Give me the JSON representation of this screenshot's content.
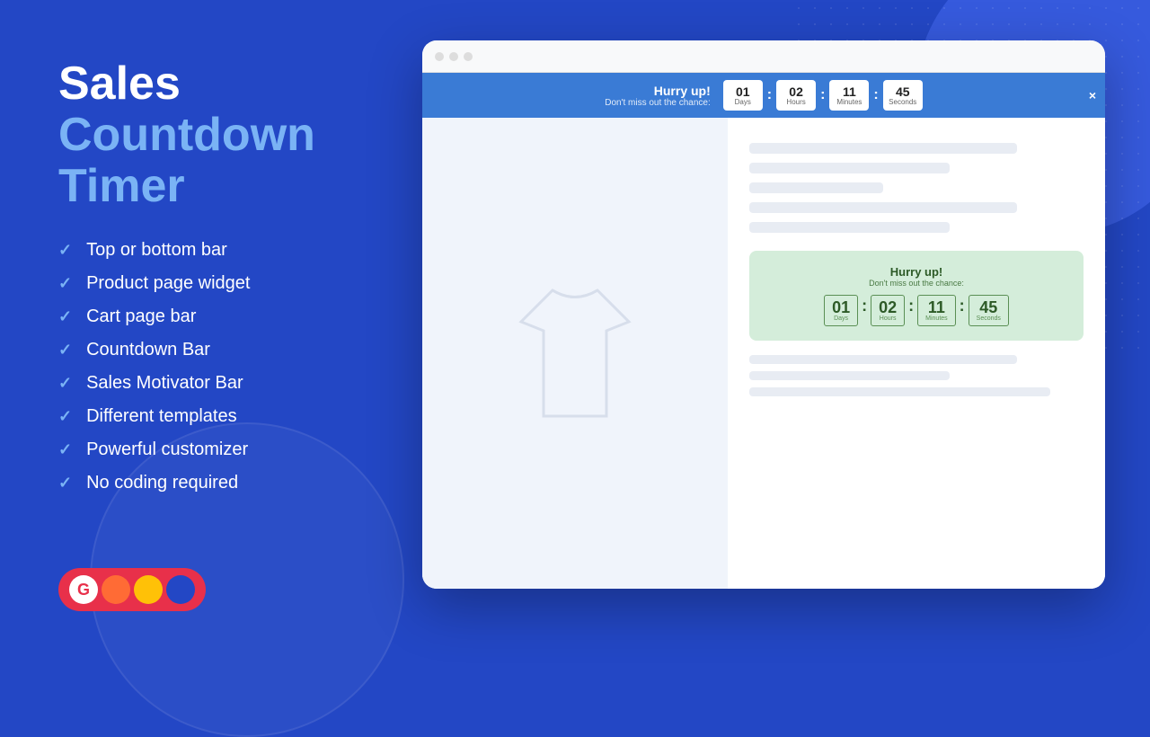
{
  "background": {
    "color": "#2347c5"
  },
  "title": {
    "word1": "Sales",
    "word2": "Countdown",
    "word3": "Timer"
  },
  "features": [
    {
      "label": "Top or bottom bar"
    },
    {
      "label": "Product page widget"
    },
    {
      "label": "Cart page bar"
    },
    {
      "label": "Countdown Bar"
    },
    {
      "label": "Sales Motivator Bar"
    },
    {
      "label": "Different templates"
    },
    {
      "label": "Powerful customizer"
    },
    {
      "label": "No coding required"
    }
  ],
  "countdown": {
    "hurry_up": "Hurry up!",
    "dont_miss": "Don't miss out the chance:",
    "days": "01",
    "hours": "02",
    "minutes": "11",
    "seconds": "45",
    "days_label": "Days",
    "hours_label": "Hours",
    "minutes_label": "Minutes",
    "seconds_label": "Seconds"
  },
  "widget": {
    "hurry_up": "Hurry up!",
    "dont_miss": "Don't miss out the chance:",
    "days": "01",
    "hours": "02",
    "minutes": "11",
    "seconds": "45",
    "days_label": "Days",
    "hours_label": "Hours",
    "minutes_label": "Minutes",
    "seconds_label": "Seconds"
  },
  "browser": {
    "dot1": "#ddd",
    "dot2": "#ddd",
    "dot3": "#ddd"
  },
  "logo": {
    "letter": "G"
  },
  "close_button": "×"
}
